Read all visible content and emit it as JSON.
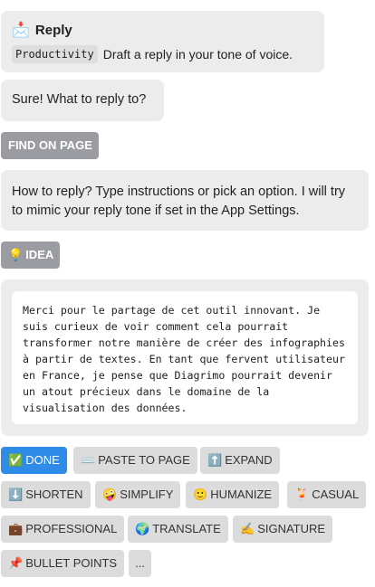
{
  "reply_card": {
    "emoji": "📩",
    "title": "Reply",
    "tag": "Productivity",
    "description": "Draft a reply in your tone of voice."
  },
  "prompt_bubble": "Sure! What to reply to?",
  "find_button": "FIND ON PAGE",
  "howto_bubble": "How to reply? Type instructions or pick an option. I will try to mimic your reply tone if set in the App Settings.",
  "idea_button": {
    "emoji": "💡",
    "label": "IDEA"
  },
  "draft_text": "Merci pour le partage de cet outil innovant. Je suis curieux de voir comment cela pourrait transformer notre manière de créer des infographies à partir de textes. En tant que fervent utilisateur en France, je pense que Diagrimo pourrait devenir un atout précieux dans le domaine de la visualisation des données.",
  "actions": [
    {
      "emoji": "✅",
      "label": "DONE"
    },
    {
      "emoji": "⌨️",
      "label": "PASTE TO PAGE"
    },
    {
      "emoji": "⬆️",
      "label": "EXPAND"
    },
    {
      "emoji": "⬇️",
      "label": "SHORTEN"
    },
    {
      "emoji": "🤪",
      "label": "SIMPLIFY"
    },
    {
      "emoji": "🙂",
      "label": "HUMANIZE"
    },
    {
      "emoji": "🍹",
      "label": "CASUAL"
    },
    {
      "emoji": "💼",
      "label": "PROFESSIONAL"
    },
    {
      "emoji": "🌍",
      "label": "TRANSLATE"
    },
    {
      "emoji": "✍️",
      "label": "SIGNATURE"
    },
    {
      "emoji": "📌",
      "label": "BULLET POINTS"
    },
    {
      "emoji": "",
      "label": "..."
    }
  ],
  "colors": {
    "bubble": "#ececec",
    "chip": "#dcdcdc",
    "grey_chip": "#9a9ca1",
    "accent": "#2e8be7"
  }
}
